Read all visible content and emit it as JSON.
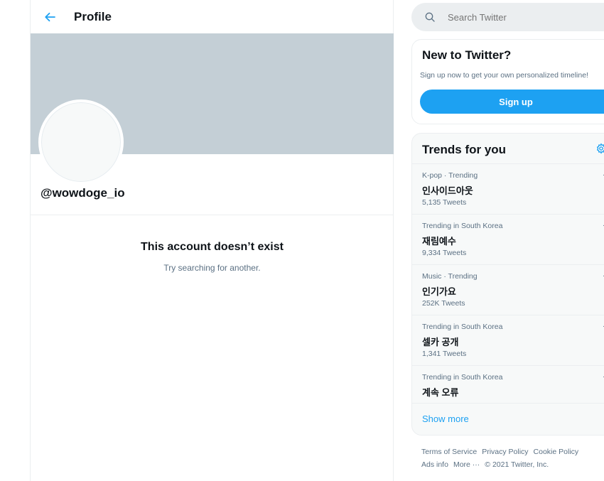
{
  "header": {
    "title": "Profile"
  },
  "profile": {
    "handle": "@wowdoge_io",
    "empty_title": "This account doesn’t exist",
    "empty_subtitle": "Try searching for another."
  },
  "search": {
    "placeholder": "Search Twitter"
  },
  "new_to_twitter": {
    "title": "New to Twitter?",
    "subtitle": "Sign up now to get your own personalized timeline!",
    "signup_label": "Sign up"
  },
  "trends": {
    "title": "Trends for you",
    "items": [
      {
        "meta": "K-pop · Trending",
        "name": "인사이드아웃",
        "count": "5,135 Tweets"
      },
      {
        "meta": "Trending in South Korea",
        "name": "재림예수",
        "count": "9,334 Tweets"
      },
      {
        "meta": "Music · Trending",
        "name": "인기가요",
        "count": "252K Tweets"
      },
      {
        "meta": "Trending in South Korea",
        "name": "셀카 공개",
        "count": "1,341 Tweets"
      },
      {
        "meta": "Trending in South Korea",
        "name": "계속 오류",
        "count": ""
      }
    ],
    "show_more": "Show more"
  },
  "footer": {
    "links": [
      "Terms of Service",
      "Privacy Policy",
      "Cookie Policy",
      "Ads info",
      "More ···"
    ],
    "copyright": "© 2021 Twitter, Inc."
  },
  "colors": {
    "accent": "#1da1f2",
    "banner": "#c4cfd6",
    "secondary_text": "#5b7083",
    "border": "#ebeef0"
  }
}
